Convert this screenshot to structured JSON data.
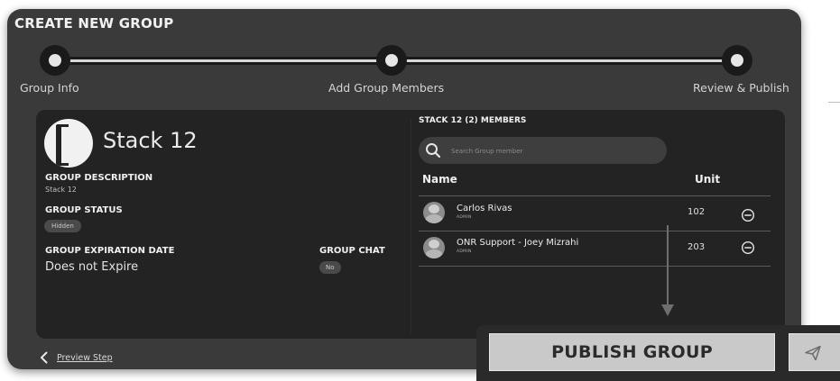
{
  "header": {
    "title": "CREATE NEW GROUP"
  },
  "stepper": {
    "steps": [
      {
        "label": "Group Info"
      },
      {
        "label": "Add Group Members"
      },
      {
        "label": "Review & Publish"
      }
    ]
  },
  "group": {
    "name": "Stack 12",
    "description_label": "GROUP DESCRIPTION",
    "description": "Stack 12",
    "status_label": "GROUP STATUS",
    "status": "Hidden",
    "expiration_label": "GROUP EXPIRATION DATE",
    "expiration": "Does not Expire",
    "chat_label": "GROUP CHAT",
    "chat": "No"
  },
  "members": {
    "title": "STACK 12 (2) MEMBERS",
    "search_placeholder": "Search Group member",
    "columns": {
      "name": "Name",
      "unit": "Unit"
    },
    "rows": [
      {
        "name": "Carlos Rivas",
        "role": "ADMIN",
        "unit": "102"
      },
      {
        "name": "ONR Support - Joey Mizrahi",
        "role": "ADMIN",
        "unit": "203"
      }
    ]
  },
  "footer": {
    "preview_label": "Preview Step",
    "publish_label": "PUBLISH GROUP"
  },
  "icons": {
    "search": "search-icon",
    "remove": "minus-circle-icon",
    "back": "chevron-left-icon",
    "send": "paper-plane-icon",
    "logo": "group-logo-icon"
  }
}
